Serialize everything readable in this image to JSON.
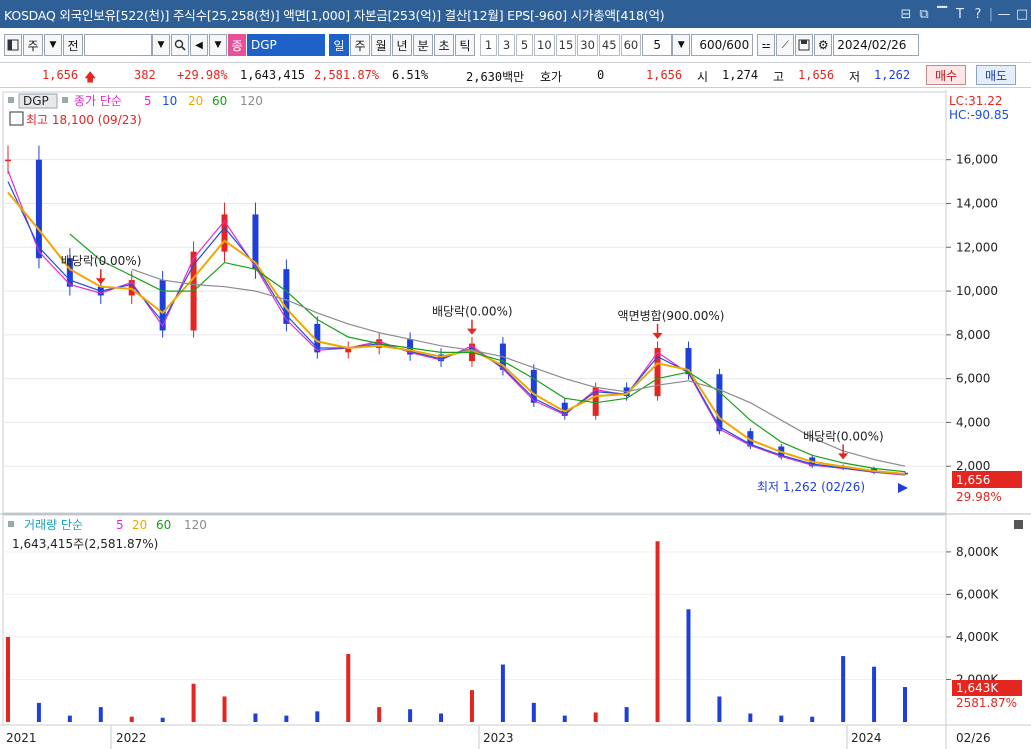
{
  "title": {
    "text": "KOSDAQ 외국인보유[522(천)] 주식수[25,258(천)] 액면[1,000] 자본금[253(억)] 결산[12월] EPS[-960] 시가총액[418(억)",
    "icons": [
      "restore-window-icon",
      "detach-window-icon",
      "pin-icon",
      "font-size-icon",
      "help-icon",
      "minimize-icon",
      "maximize-icon"
    ],
    "icon_glyphs": [
      "⊟",
      "⧉",
      "▔",
      "T",
      "?",
      "—",
      "□"
    ]
  },
  "toolbar": {
    "market_label": "주",
    "jeon_label": "전",
    "code_value": "",
    "stock_badge": "종",
    "stock_name": "DGP",
    "periods": [
      "일",
      "주",
      "월",
      "년",
      "분",
      "초",
      "틱"
    ],
    "active_period": "일",
    "intervals": [
      "1",
      "3",
      "5",
      "10",
      "15",
      "30",
      "45",
      "60"
    ],
    "select_value": "5",
    "count_value": "600",
    "count_total": "/600",
    "date_value": "2024/02/26"
  },
  "quote": {
    "price": "1,656",
    "change": "382",
    "change_pct": "+29.98%",
    "volume": "1,643,415",
    "volume_ratio": "2,581.87%",
    "turnover": "6.51%",
    "amount": "2,630백만",
    "hoga_label": "호가",
    "hoga_value": "0",
    "open_price": "1,656",
    "open_label": "시",
    "open_value": "1,274",
    "high_label": "고",
    "high_value": "1,656",
    "low_label": "저",
    "low_value": "1,262",
    "buy_label": "매수",
    "sell_label": "매도"
  },
  "price_panel": {
    "name_tag": "DGP",
    "legend_title": "종가 단순",
    "ma_periods": [
      "5",
      "10",
      "20",
      "60",
      "120"
    ],
    "ma_colors": [
      "#e62ad0",
      "#1e4ee0",
      "#f0a800",
      "#18a018",
      "#8c8c8c"
    ],
    "high_note": "최고 18,100 (09/23)",
    "lc": "LC:31.22",
    "hc": "HC:-90.85",
    "low_note": "최저 1,262 (02/26)",
    "last_price_tag": "1,656",
    "last_pct_tag": "29.98%"
  },
  "volume_panel": {
    "legend_title": "거래량 단순",
    "ma_periods": [
      "5",
      "20",
      "60",
      "120"
    ],
    "ma_colors": [
      "#e62ad0",
      "#f0a800",
      "#18a018",
      "#8c8c8c"
    ],
    "current_text": "1,643,415주(2,581.87%)",
    "last_tag": "1,643K",
    "last_pct": "2581.87%"
  },
  "x_axis": {
    "labels": [
      "2021",
      "2022",
      "2023",
      "2024"
    ],
    "end_label": "02/26"
  },
  "chart_data": [
    {
      "type": "candlestick",
      "title": "DGP",
      "ylim": [
        0,
        19000
      ],
      "yticks": [
        2000,
        4000,
        6000,
        8000,
        10000,
        12000,
        14000,
        16000
      ],
      "ytick_labels": [
        "2,000",
        "4,000",
        "6,000",
        "8,000",
        "10,000",
        "12,000",
        "14,000",
        "16,000"
      ],
      "x": [
        "2021-09",
        "2021-10",
        "2021-11",
        "2021-12",
        "2022-01",
        "2022-02",
        "2022-03",
        "2022-04",
        "2022-05",
        "2022-06",
        "2022-07",
        "2022-08",
        "2022-09",
        "2022-10",
        "2022-11",
        "2022-12",
        "2023-01",
        "2023-02",
        "2023-03",
        "2023-04",
        "2023-05",
        "2023-06",
        "2023-07",
        "2023-08",
        "2023-09",
        "2023-10",
        "2023-11",
        "2023-12",
        "2024-01",
        "2024-02"
      ],
      "series": [
        {
          "name": "종가",
          "values": [
            16000,
            11500,
            10200,
            9800,
            10500,
            8200,
            11800,
            13500,
            11000,
            8500,
            7200,
            7400,
            7800,
            7100,
            6800,
            7600,
            6400,
            4900,
            4300,
            5600,
            5200,
            7400,
            6200,
            3600,
            2900,
            2400,
            2000,
            1900,
            1700,
            1656
          ]
        },
        {
          "name": "5",
          "values": [
            15500,
            11800,
            10300,
            9900,
            10400,
            8400,
            11500,
            13200,
            11100,
            8700,
            7300,
            7400,
            7700,
            7200,
            6850,
            7500,
            6450,
            5000,
            4350,
            5500,
            5250,
            7200,
            6250,
            3700,
            2950,
            2450,
            2050,
            1900,
            1720,
            1600
          ]
        },
        {
          "name": "10",
          "values": [
            15000,
            12000,
            10500,
            10000,
            10300,
            8600,
            11200,
            12900,
            11200,
            8900,
            7400,
            7400,
            7600,
            7250,
            6900,
            7400,
            6500,
            5100,
            4400,
            5400,
            5300,
            7000,
            6300,
            3800,
            3000,
            2500,
            2100,
            1920,
            1740,
            1620
          ]
        },
        {
          "name": "20",
          "values": [
            14500,
            12800,
            11000,
            10200,
            10100,
            9000,
            10600,
            12300,
            11300,
            9200,
            7700,
            7400,
            7500,
            7300,
            7000,
            7300,
            6600,
            5300,
            4500,
            5200,
            5300,
            6700,
            6400,
            4200,
            3200,
            2650,
            2200,
            1980,
            1780,
            1650
          ]
        },
        {
          "name": "60",
          "values": [
            null,
            null,
            12600,
            11400,
            10700,
            10000,
            10000,
            11300,
            11000,
            10000,
            8700,
            7900,
            7600,
            7400,
            7200,
            7200,
            6800,
            6000,
            5100,
            4900,
            5100,
            6000,
            6300,
            5400,
            4100,
            3100,
            2500,
            2150,
            1900,
            1750
          ]
        },
        {
          "name": "120",
          "values": [
            null,
            null,
            null,
            null,
            11000,
            10500,
            10300,
            10200,
            10000,
            9600,
            9000,
            8500,
            8100,
            7800,
            7500,
            7300,
            7000,
            6500,
            6000,
            5600,
            5400,
            5700,
            5900,
            5500,
            4900,
            4100,
            3300,
            2700,
            2300,
            2000
          ]
        }
      ],
      "annotations": [
        {
          "text": "배당락(0.00%)",
          "x": "2021-12"
        },
        {
          "text": "배당락(0.00%)",
          "x": "2022-12"
        },
        {
          "text": "액면병합(900.00%)",
          "x": "2023-06"
        },
        {
          "text": "배당락(0.00%)",
          "x": "2023-12"
        }
      ]
    },
    {
      "type": "bar",
      "title": "거래량",
      "ylim": [
        0,
        9500
      ],
      "yticks": [
        2000,
        4000,
        6000,
        8000
      ],
      "ytick_labels": [
        "2,000K",
        "4,000K",
        "6,000K",
        "8,000K"
      ],
      "x": [
        "2021-09",
        "2021-10",
        "2021-11",
        "2021-12",
        "2022-01",
        "2022-02",
        "2022-03",
        "2022-04",
        "2022-05",
        "2022-06",
        "2022-07",
        "2022-08",
        "2022-09",
        "2022-10",
        "2022-11",
        "2022-12",
        "2023-01",
        "2023-02",
        "2023-03",
        "2023-04",
        "2023-05",
        "2023-06",
        "2023-07",
        "2023-08",
        "2023-09",
        "2023-10",
        "2023-11",
        "2023-12",
        "2024-01",
        "2024-02"
      ],
      "series": [
        {
          "name": "거래량",
          "values": [
            4000,
            900,
            300,
            700,
            250,
            200,
            1800,
            1200,
            400,
            300,
            500,
            3200,
            700,
            600,
            400,
            1500,
            2700,
            900,
            300,
            450,
            700,
            8500,
            5300,
            1200,
            400,
            300,
            250,
            3100,
            2600,
            1643
          ]
        }
      ]
    }
  ]
}
